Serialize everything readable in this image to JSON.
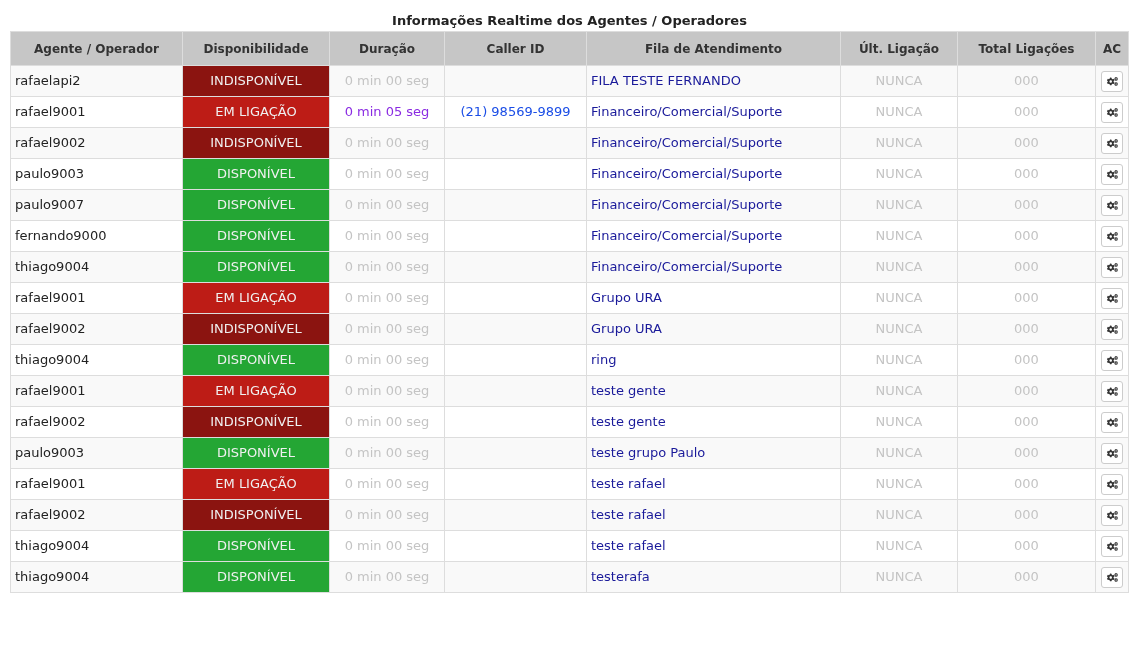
{
  "title": "Informações Realtime dos Agentes / Operadores",
  "columns": [
    "Agente / Operador",
    "Disponibilidade",
    "Duração",
    "Caller ID",
    "Fila de Atendimento",
    "Últ. Ligação",
    "Total Ligações",
    "AC"
  ],
  "rows": [
    {
      "agent": "rafaelapi2",
      "status": {
        "kind": "unavailable",
        "text": "INDISPONÍVEL"
      },
      "duration": {
        "text": "0 min 00 seg",
        "active": false
      },
      "queue": "FILA TESTE FERNANDO",
      "last_call": "NUNCA",
      "total": "000"
    },
    {
      "agent": "rafael9001",
      "status": {
        "kind": "on_call",
        "text": "EM LIGAÇÃO"
      },
      "duration": {
        "text": "0 min 05 seg",
        "active": true
      },
      "caller_id": "(21) 98569-9899",
      "queue": "Financeiro/Comercial/Suporte",
      "last_call": "NUNCA",
      "total": "000"
    },
    {
      "agent": "rafael9002",
      "status": {
        "kind": "unavailable",
        "text": "INDISPONÍVEL"
      },
      "duration": {
        "text": "0 min 00 seg",
        "active": false
      },
      "caller_id": "",
      "queue": "Financeiro/Comercial/Suporte",
      "last_call": "NUNCA",
      "total": "000"
    },
    {
      "agent": "paulo9003",
      "status": {
        "kind": "available",
        "text": "DISPONÍVEL"
      },
      "duration": {
        "text": "0 min 00 seg",
        "active": false
      },
      "caller_id": "",
      "queue": "Financeiro/Comercial/Suporte",
      "last_call": "NUNCA",
      "total": "000"
    },
    {
      "agent": "paulo9007",
      "status": {
        "kind": "available",
        "text": "DISPONÍVEL"
      },
      "duration": {
        "text": "0 min 00 seg",
        "active": false
      },
      "caller_id": "",
      "queue": "Financeiro/Comercial/Suporte",
      "last_call": "NUNCA",
      "total": "000"
    },
    {
      "agent": "fernando9000",
      "status": {
        "kind": "available",
        "text": "DISPONÍVEL"
      },
      "duration": {
        "text": "0 min 00 seg",
        "active": false
      },
      "caller_id": "",
      "queue": "Financeiro/Comercial/Suporte",
      "last_call": "NUNCA",
      "total": "000"
    },
    {
      "agent": "thiago9004",
      "status": {
        "kind": "available",
        "text": "DISPONÍVEL"
      },
      "duration": {
        "text": "0 min 00 seg",
        "active": false
      },
      "caller_id": "",
      "queue": "Financeiro/Comercial/Suporte",
      "last_call": "NUNCA",
      "total": "000"
    },
    {
      "agent": "rafael9001",
      "status": {
        "kind": "on_call",
        "text": "EM LIGAÇÃO"
      },
      "duration": {
        "text": "0 min 00 seg",
        "active": false
      },
      "caller_id": "",
      "queue": "Grupo URA",
      "last_call": "NUNCA",
      "total": "000"
    },
    {
      "agent": "rafael9002",
      "status": {
        "kind": "unavailable",
        "text": "INDISPONÍVEL"
      },
      "duration": {
        "text": "0 min 00 seg",
        "active": false
      },
      "caller_id": "",
      "queue": "Grupo URA",
      "last_call": "NUNCA",
      "total": "000"
    },
    {
      "agent": "thiago9004",
      "status": {
        "kind": "available",
        "text": "DISPONÍVEL"
      },
      "duration": {
        "text": "0 min 00 seg",
        "active": false
      },
      "caller_id": "",
      "queue": "ring",
      "last_call": "NUNCA",
      "total": "000"
    },
    {
      "agent": "rafael9001",
      "status": {
        "kind": "on_call",
        "text": "EM LIGAÇÃO"
      },
      "duration": {
        "text": "0 min 00 seg",
        "active": false
      },
      "caller_id": "",
      "queue": "teste gente",
      "last_call": "NUNCA",
      "total": "000"
    },
    {
      "agent": "rafael9002",
      "status": {
        "kind": "unavailable",
        "text": "INDISPONÍVEL"
      },
      "duration": {
        "text": "0 min 00 seg",
        "active": false
      },
      "caller_id": "",
      "queue": "teste gente",
      "last_call": "NUNCA",
      "total": "000"
    },
    {
      "agent": "paulo9003",
      "status": {
        "kind": "available",
        "text": "DISPONÍVEL"
      },
      "duration": {
        "text": "0 min 00 seg",
        "active": false
      },
      "caller_id": "",
      "queue": "teste grupo Paulo",
      "last_call": "NUNCA",
      "total": "000"
    },
    {
      "agent": "rafael9001",
      "status": {
        "kind": "on_call",
        "text": "EM LIGAÇÃO"
      },
      "duration": {
        "text": "0 min 00 seg",
        "active": false
      },
      "caller_id": "",
      "queue": "teste rafael",
      "last_call": "NUNCA",
      "total": "000"
    },
    {
      "agent": "rafael9002",
      "status": {
        "kind": "unavailable",
        "text": "INDISPONÍVEL"
      },
      "duration": {
        "text": "0 min 00 seg",
        "active": false
      },
      "caller_id": "",
      "queue": "teste rafael",
      "last_call": "NUNCA",
      "total": "000"
    },
    {
      "agent": "thiago9004",
      "status": {
        "kind": "available",
        "text": "DISPONÍVEL"
      },
      "duration": {
        "text": "0 min 00 seg",
        "active": false
      },
      "caller_id": "",
      "queue": "teste rafael",
      "last_call": "NUNCA",
      "total": "000"
    },
    {
      "agent": "thiago9004",
      "status": {
        "kind": "available",
        "text": "DISPONÍVEL"
      },
      "duration": {
        "text": "0 min 00 seg",
        "active": false
      },
      "caller_id": "",
      "queue": "testerafa",
      "last_call": "NUNCA",
      "total": "000"
    }
  ]
}
